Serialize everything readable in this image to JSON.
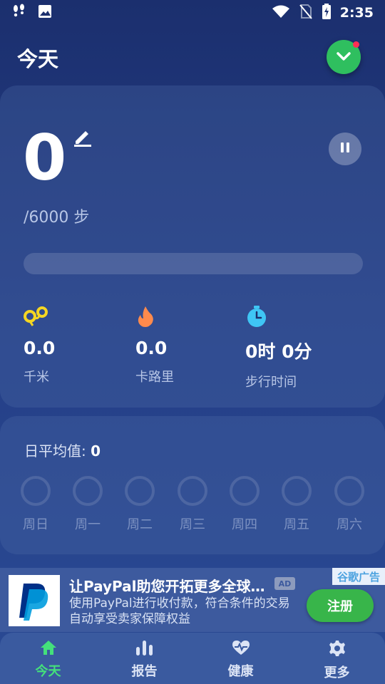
{
  "status_bar": {
    "time": "2:35"
  },
  "header": {
    "title": "今天"
  },
  "steps": {
    "count": "0",
    "goal_text": "/6000 步",
    "progress_fraction": 0
  },
  "stats": [
    {
      "value": "0.0",
      "label": "千米",
      "icon": "route-icon"
    },
    {
      "value": "0.0",
      "label": "卡路里",
      "icon": "flame-icon"
    },
    {
      "value": "0时 0分",
      "label": "步行时间",
      "icon": "stopwatch-icon"
    }
  ],
  "daily_average": {
    "label": "日平均值: ",
    "value": "0"
  },
  "week": {
    "days": [
      "周日",
      "周一",
      "周二",
      "周三",
      "周四",
      "周五",
      "周六"
    ]
  },
  "ad": {
    "title": "让PayPal助您开拓更多全球…",
    "badge": "AD",
    "corner_label": "谷歌广告",
    "description": "使用PayPal进行收付款，符合条件的交易自动享受卖家保障权益",
    "cta": "注册"
  },
  "nav": {
    "items": [
      {
        "label": "今天",
        "icon": "home-icon",
        "active": true
      },
      {
        "label": "报告",
        "icon": "bar-chart-icon",
        "active": false
      },
      {
        "label": "健康",
        "icon": "heart-pulse-icon",
        "active": false
      },
      {
        "label": "更多",
        "icon": "gear-icon",
        "active": false
      }
    ]
  },
  "colors": {
    "accent_green": "#2fbf5f",
    "nav_active": "#44e07b",
    "route_icon": "#f5d622",
    "flame_icon": "#ff8a4c",
    "stopwatch_icon": "#3fc6f5"
  }
}
